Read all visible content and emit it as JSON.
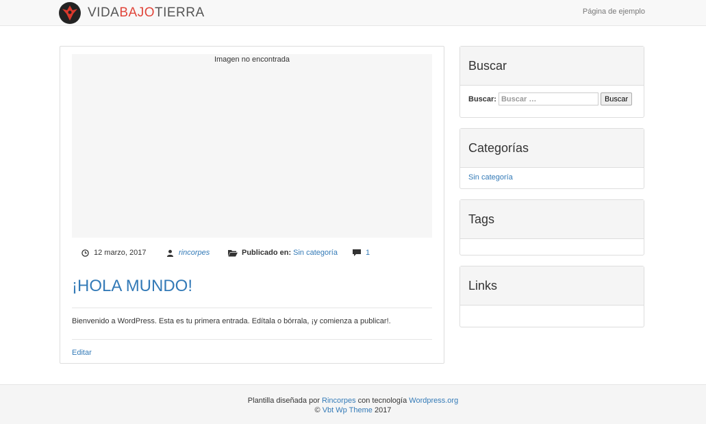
{
  "header": {
    "brand_part1": "VIDA",
    "brand_part2": "BAJO",
    "brand_part3": "TIERRA",
    "nav_link": "Página de ejemplo",
    "brand_accent_color": "#e0453a"
  },
  "post": {
    "image_alt": "Imagen no encontrada",
    "date": "12 marzo, 2017",
    "author": "rincorpes",
    "published_label": "Publicado en:",
    "category": "Sin categoría",
    "comments": "1",
    "title": "¡HOLA MUNDO!",
    "excerpt": "Bienvenido a WordPress. Esta es tu primera entrada. Edítala o bórrala, ¡y comienza a publicar!.",
    "edit_label": "Editar"
  },
  "sidebar": {
    "search": {
      "title": "Buscar",
      "label": "Buscar:",
      "placeholder": "Buscar …",
      "button": "Buscar"
    },
    "categories": {
      "title": "Categorías",
      "items": [
        "Sin categoría"
      ]
    },
    "tags": {
      "title": "Tags"
    },
    "links": {
      "title": "Links"
    }
  },
  "footer": {
    "prefix": "Plantilla diseñada por",
    "designer": "Rincorpes",
    "middle": "con tecnología",
    "platform": "Wordpress.org",
    "copyright_symbol": "©",
    "theme": "Vbt Wp Theme",
    "year": "2017"
  },
  "icons": {
    "date": "clock-icon",
    "author": "user-icon",
    "category": "folder-open-icon",
    "comments": "comment-icon"
  }
}
